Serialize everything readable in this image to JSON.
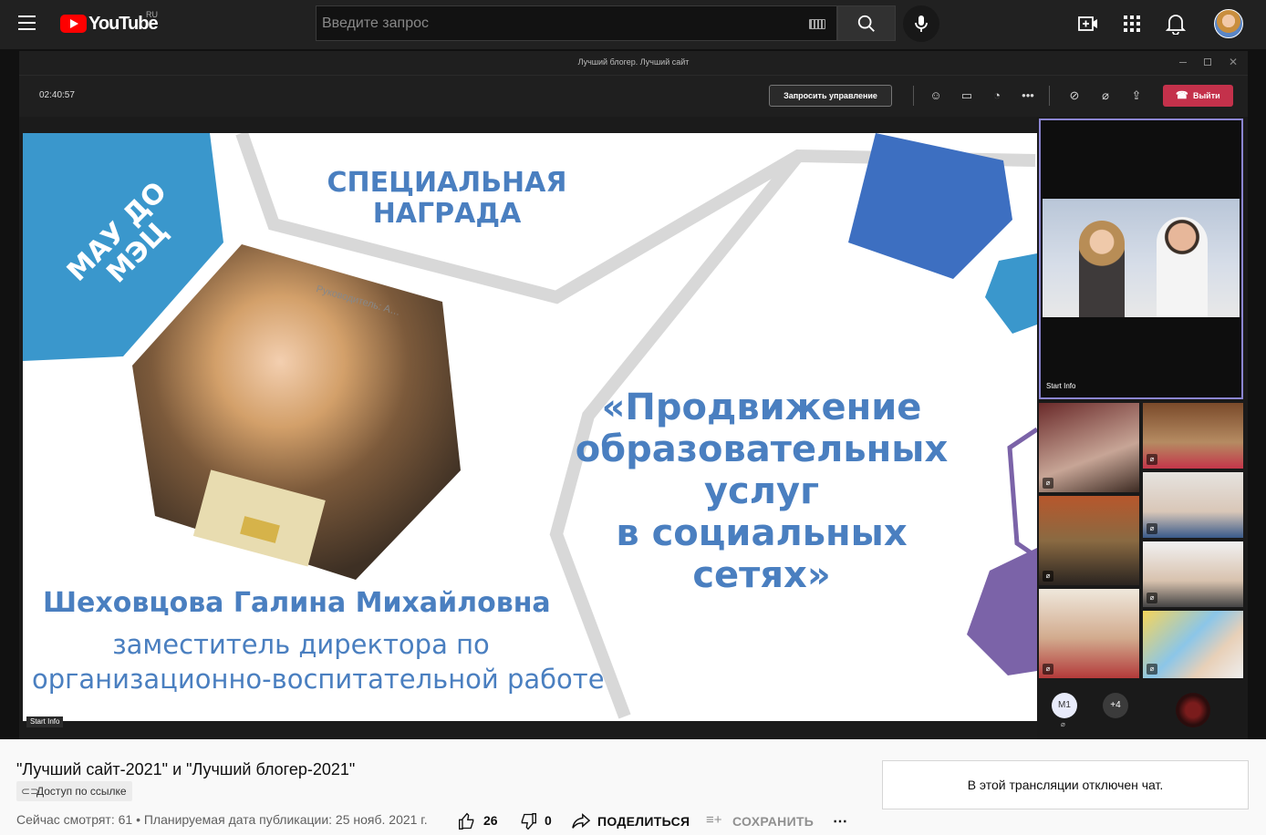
{
  "youtube": {
    "logo_text": "YouTube",
    "region": "RU",
    "search_placeholder": "Введите запрос"
  },
  "teams": {
    "window_title": "Лучший блогер. Лучший сайт",
    "timer": "02:40:57",
    "request_control_label": "Запросить управление",
    "leave_label": "Выйти",
    "icons": [
      "people-icon",
      "chat-icon",
      "reactions-icon",
      "more-icon",
      "camera-off-icon",
      "mic-off-icon",
      "share-icon",
      "phone-icon"
    ]
  },
  "slide": {
    "award_line1": "СПЕЦИАЛЬНАЯ",
    "award_line2": "НАГРАДА",
    "org_line1": "МАУ ДО",
    "org_line2": "МЭЦ",
    "project_lines": [
      "«Продвижение",
      "образовательных",
      "услуг",
      "в социальных",
      "сетях»"
    ],
    "person_name": "Шеховцова Галина Михайловна",
    "position_line1": "заместитель директора по",
    "position_line2": "организационно-воспитательной работе",
    "photo_caption": "Руководитель: А…",
    "presenter_label": "Start Info",
    "colors": {
      "blue": "#3a86c8",
      "dark_blue": "#3d6fc1",
      "purple": "#7b63a8",
      "title_blue": "#4a7fc0"
    }
  },
  "participants": {
    "main_tile_label": "Start Info",
    "avatar_initials": "М1",
    "more_count": "+4"
  },
  "video_info": {
    "title": "\"Лучший сайт-2021\" и \"Лучший блогер-2021\"",
    "privacy": "Доступ по ссылке",
    "meta": "Сейчас смотрят: 61 • Планируемая дата публикации: 25 нояб. 2021 г.",
    "likes": "26",
    "dislikes": "0",
    "share_label": "ПОДЕЛИТЬСЯ",
    "save_label": "СОХРАНИТЬ",
    "chat_disabled": "В этой трансляции отключен чат."
  }
}
